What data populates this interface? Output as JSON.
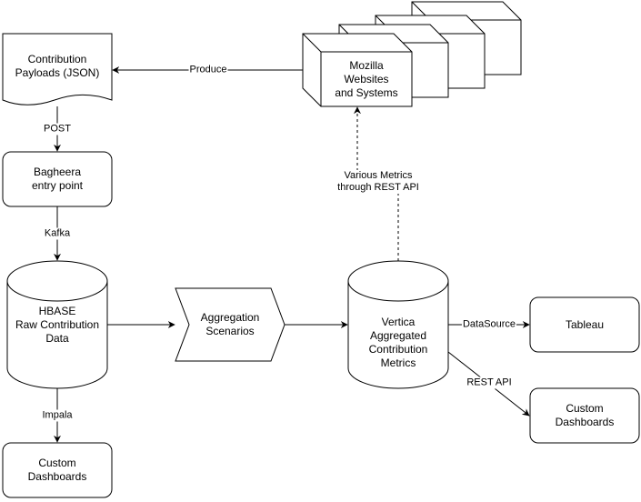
{
  "diagram": {
    "colors": {
      "stroke": "#000000",
      "fill": "#ffffff",
      "text": "#000000"
    },
    "nodes": {
      "payloads": {
        "label": "Contribution\nPayloads (JSON)",
        "shape": "document"
      },
      "mozilla": {
        "label": "Mozilla\nWebsites\nand Systems",
        "shape": "stacked-cubes"
      },
      "bagheera": {
        "label": "Bagheera\nentry point",
        "shape": "rounded-rect"
      },
      "hbase": {
        "label": "HBASE\nRaw Contribution\nData",
        "shape": "cylinder"
      },
      "aggregation": {
        "label": "Aggregation\nScenarios",
        "shape": "step"
      },
      "vertica": {
        "label": "Vertica\nAggregated\nContribution\nMetrics",
        "shape": "cylinder"
      },
      "tableau": {
        "label": "Tableau",
        "shape": "rounded-rect"
      },
      "custom_right": {
        "label": "Custom\nDashboards",
        "shape": "rounded-rect"
      },
      "custom_left": {
        "label": "Custom\nDashboards",
        "shape": "rounded-rect"
      }
    },
    "edges": {
      "produce": {
        "label": "Produce",
        "from": "mozilla",
        "to": "payloads",
        "style": "solid"
      },
      "post": {
        "label": "POST",
        "from": "payloads",
        "to": "bagheera",
        "style": "solid"
      },
      "kafka": {
        "label": "Kafka",
        "from": "bagheera",
        "to": "hbase",
        "style": "solid"
      },
      "impala": {
        "label": "Impala",
        "from": "hbase",
        "to": "custom_left",
        "style": "solid"
      },
      "hbase_to_agg": {
        "label": "",
        "from": "hbase",
        "to": "aggregation",
        "style": "solid"
      },
      "agg_to_vertica": {
        "label": "",
        "from": "aggregation",
        "to": "vertica",
        "style": "solid"
      },
      "metrics": {
        "label": "Various Metrics\nthrough REST API",
        "from": "vertica",
        "to": "mozilla",
        "style": "dashed"
      },
      "datasource": {
        "label": "DataSource",
        "from": "vertica",
        "to": "tableau",
        "style": "solid"
      },
      "rest_api": {
        "label": "REST API",
        "from": "vertica",
        "to": "custom_right",
        "style": "solid"
      }
    }
  }
}
